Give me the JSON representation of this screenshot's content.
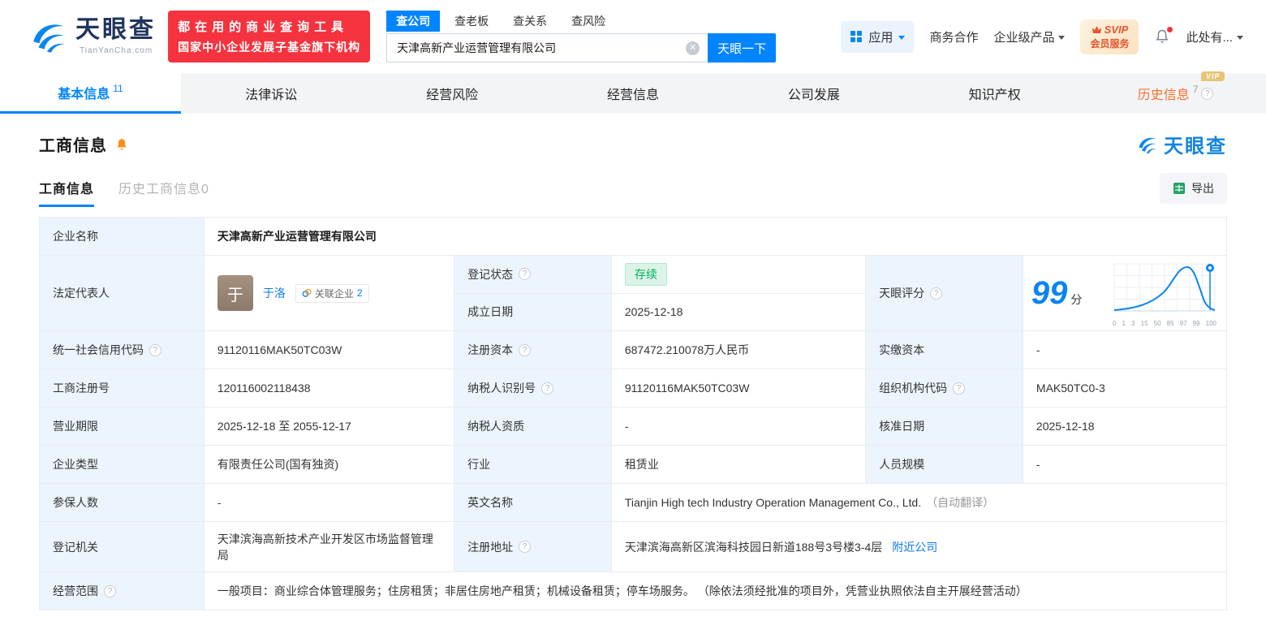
{
  "header": {
    "brand": "天眼查",
    "brand_domain": "TianYanCha.com",
    "promo_line1": "都在用的商业查询工具",
    "promo_line2": "国家中小企业发展子基金旗下机构",
    "search_tabs": [
      {
        "label": "查公司"
      },
      {
        "label": "查老板"
      },
      {
        "label": "查关系"
      },
      {
        "label": "查风险"
      }
    ],
    "search_value": "天津高新产业运营管理有限公司",
    "search_button": "天眼一下",
    "apps_label": "应用",
    "cooperation": "商务合作",
    "enterprise": "企业级产品",
    "svip_title": "SVIP",
    "svip_subtitle": "会员服务",
    "account": "此处有..."
  },
  "nav": {
    "tabs": [
      {
        "label": "基本信息",
        "count": "11"
      },
      {
        "label": "法律诉讼"
      },
      {
        "label": "经营风险"
      },
      {
        "label": "经营信息"
      },
      {
        "label": "公司发展"
      },
      {
        "label": "知识产权"
      },
      {
        "label": "历史信息",
        "count": "7"
      }
    ],
    "vip_tag": "VIP"
  },
  "section": {
    "title": "工商信息",
    "watermark": "天眼查",
    "subtabs": [
      {
        "label": "工商信息"
      },
      {
        "label": "历史工商信息0"
      }
    ],
    "export_label": "导出"
  },
  "business": {
    "name_label": "企业名称",
    "name": "天津高新产业运营管理有限公司",
    "legal_rep_label": "法定代表人",
    "legal_rep_initial": "于",
    "legal_rep_name": "于洛",
    "related_label": "关联企业",
    "related_count": "2",
    "status_label": "登记状态",
    "status_value": "存续",
    "establish_label": "成立日期",
    "establish_value": "2025-12-18",
    "score_label": "天眼评分",
    "score_value": "99",
    "score_unit": "分",
    "score_axis": [
      "0",
      "1",
      "3",
      "15",
      "50",
      "85",
      "97",
      "99",
      "100"
    ],
    "rows": [
      {
        "cells": [
          {
            "label": "统一社会信用代码",
            "value": "91120116MAK50TC03W"
          },
          {
            "label": "注册资本",
            "value": "687472.210078万人民币"
          },
          {
            "label": "实缴资本",
            "value": "-"
          }
        ]
      },
      {
        "cells": [
          {
            "label": "工商注册号",
            "value": "120116002118438"
          },
          {
            "label": "纳税人识别号",
            "value": "91120116MAK50TC03W"
          },
          {
            "label": "组织机构代码",
            "value": "MAK50TC0-3"
          }
        ]
      },
      {
        "cells": [
          {
            "label": "营业期限",
            "value": "2025-12-18 至 2055-12-17"
          },
          {
            "label": "纳税人资质",
            "value": "-"
          },
          {
            "label": "核准日期",
            "value": "2025-12-18"
          }
        ]
      },
      {
        "cells": [
          {
            "label": "企业类型",
            "value": "有限责任公司(国有独资)"
          },
          {
            "label": "行业",
            "value": "租赁业"
          },
          {
            "label": "人员规模",
            "value": "-"
          }
        ]
      }
    ],
    "insured_label": "参保人数",
    "insured_value": "-",
    "english_label": "英文名称",
    "english_value": "Tianjin High tech Industry Operation Management Co., Ltd.",
    "english_note": "（自动翻译）",
    "registry_label": "登记机关",
    "registry_value": "天津滨海高新技术产业开发区市场监督管理局",
    "address_label": "注册地址",
    "address_value": "天津滨海高新区滨海科技园日新道188号3号楼3-4层",
    "address_link": "附近公司",
    "scope_label": "经营范围",
    "scope_value": "一般项目：商业综合体管理服务；住房租赁；非居住房地产租赁；机械设备租赁；停车场服务。 （除依法须经批准的项目外，凭营业执照依法自主开展经营活动）"
  }
}
